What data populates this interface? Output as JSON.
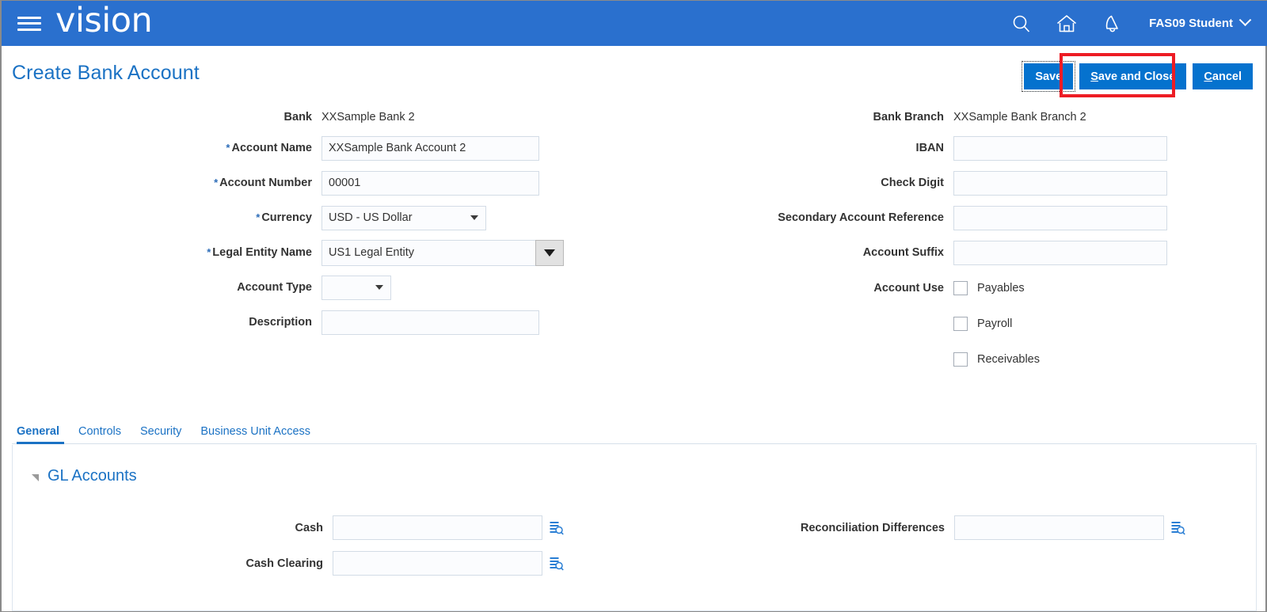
{
  "header": {
    "brand": "vision",
    "menu_icon": "hamburger-menu-icon",
    "search_icon": "search-icon",
    "home_icon": "home-icon",
    "notifications_icon": "bell-icon",
    "user_name": "FAS09 Student"
  },
  "page": {
    "title": "Create Bank Account"
  },
  "toolbar": {
    "save_label": "Save",
    "save_and_close_label": "Save and Close",
    "save_and_close_prefix": "S",
    "save_and_close_rest": "ave and Close",
    "cancel_prefix": "C",
    "cancel_rest": "ancel",
    "cancel_label": "Cancel"
  },
  "form": {
    "left": {
      "bank_label": "Bank",
      "bank_value": "XXSample Bank 2",
      "account_name_label": "Account Name",
      "account_name_value": "XXSample Bank Account 2",
      "account_number_label": "Account Number",
      "account_number_value": "00001",
      "currency_label": "Currency",
      "currency_value": "USD - US Dollar",
      "legal_entity_label": "Legal Entity Name",
      "legal_entity_value": "US1 Legal Entity",
      "account_type_label": "Account Type",
      "account_type_value": "",
      "description_label": "Description",
      "description_value": ""
    },
    "right": {
      "bank_branch_label": "Bank Branch",
      "bank_branch_value": "XXSample Bank Branch 2",
      "iban_label": "IBAN",
      "iban_value": "",
      "check_digit_label": "Check Digit",
      "check_digit_value": "",
      "secondary_account_reference_label": "Secondary Account Reference",
      "secondary_account_reference_value": "",
      "account_suffix_label": "Account Suffix",
      "account_suffix_value": "",
      "account_use_label": "Account Use",
      "account_use_options": [
        {
          "label": "Payables",
          "checked": false
        },
        {
          "label": "Payroll",
          "checked": false
        },
        {
          "label": "Receivables",
          "checked": false
        }
      ]
    },
    "required_marker": "*"
  },
  "tabs": [
    {
      "label": "General",
      "active": true
    },
    {
      "label": "Controls",
      "active": false
    },
    {
      "label": "Security",
      "active": false
    },
    {
      "label": "Business Unit Access",
      "active": false
    }
  ],
  "gl_accounts": {
    "section_title": "GL Accounts",
    "collapse_icon": "triangle-collapse-icon",
    "left": {
      "cash_label": "Cash",
      "cash_value": "",
      "cash_clearing_label": "Cash Clearing",
      "cash_clearing_value": ""
    },
    "right": {
      "reconciliation_differences_label": "Reconciliation Differences",
      "reconciliation_differences_value": ""
    },
    "lov_icon": "account-lov-search-icon"
  },
  "annotation": {
    "highlight_target": "Save and Close",
    "color": "#ed1c24"
  },
  "colors": {
    "header_blue": "#2a70ce",
    "button_blue": "#0572ce",
    "link_blue": "#1b72c4",
    "field_bg": "#fbfcfe",
    "field_border": "#d3dce6"
  }
}
